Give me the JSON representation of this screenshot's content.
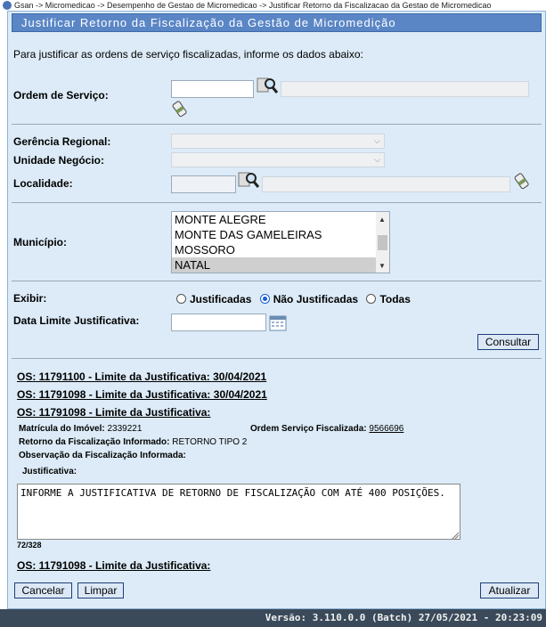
{
  "breadcrumb": "Gsan -> Micromedicao -> Desempenho de Gestao de Micromedicao -> Justificar Retorno da Fiscalizacao da Gestao de Micromedicao",
  "title": "Justificar Retorno da Fiscalização da Gestão de Micromedição",
  "intro": "Para justificar as ordens de serviço fiscalizadas, informe os dados abaixo:",
  "labels": {
    "ordem_servico": "Ordem de Serviço:",
    "gerencia": "Gerência Regional:",
    "unidade": "Unidade Negócio:",
    "localidade": "Localidade:",
    "municipio": "Município:",
    "exibir": "Exibir:",
    "data_limite": "Data Limite Justificativa:"
  },
  "municipios": [
    "MONTE ALEGRE",
    "MONTE DAS GAMELEIRAS",
    "MOSSORO",
    "NATAL"
  ],
  "exibir_options": [
    "Justificadas",
    "Não Justificadas",
    "Todas"
  ],
  "buttons": {
    "consultar": "Consultar",
    "cancelar": "Cancelar",
    "limpar": "Limpar",
    "atualizar": "Atualizar"
  },
  "os_list": [
    "OS: 11791100 - Limite da Justificativa: 30/04/2021",
    "OS: 11791098 - Limite da Justificativa: 30/04/2021",
    "OS: 11791098 - Limite da Justificativa:"
  ],
  "detail": {
    "matricula_label": "Matrícula do Imóvel:",
    "matricula_value": "2339221",
    "ordem_fisc_label": "Ordem Serviço Fiscalizada:",
    "ordem_fisc_value": "9566696",
    "retorno_label": "Retorno da Fiscalização Informado:",
    "retorno_value": "RETORNO TIPO 2",
    "observacao_label": "Observação da Fiscalização Informada:",
    "justificativa_label": "Justificativa:",
    "justificativa_text": "INFORME A JUSTIFICATIVA DE RETORNO DE FISCALIZAÇÃO COM ATÉ 400 POSIÇÕES.",
    "counter": "72/328"
  },
  "os_last": "OS: 11791098 - Limite da Justificativa:",
  "footer": "Versão: 3.110.0.0 (Batch) 27/05/2021 - 20:23:09"
}
